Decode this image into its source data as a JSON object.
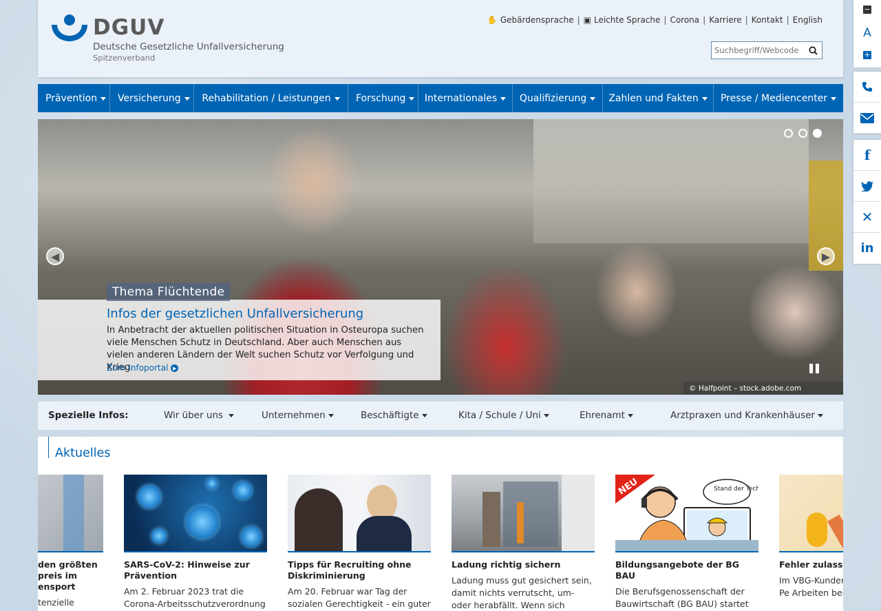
{
  "header": {
    "logo": {
      "brand": "DGUV",
      "line1": "Deutsche Gesetzliche Unfallversicherung",
      "line2": "Spitzenverband"
    },
    "topnav": [
      {
        "label": "Gebärdensprache",
        "icon": "sign-language-icon"
      },
      {
        "label": "Leichte Sprache",
        "icon": "easy-language-icon"
      },
      {
        "label": "Corona"
      },
      {
        "label": "Karriere"
      },
      {
        "label": "Kontakt"
      },
      {
        "label": "English"
      }
    ],
    "search": {
      "placeholder": "Suchbegriff/Webcode"
    }
  },
  "mainnav": [
    "Prävention",
    "Versicherung",
    "Rehabilitation / Leistungen",
    "Forschung",
    "Internationales",
    "Qualifizierung",
    "Zahlen und Fakten",
    "Presse / Mediencenter"
  ],
  "hero": {
    "tag": "Thema Flüchtende",
    "title": "Infos der gesetzlichen Unfallversicherung",
    "text": "In Anbetracht der aktuellen politischen Situation in Osteuropa suchen viele Menschen Schutz in Deutschland. Aber auch Menschen aus vielen anderen Ländern der Welt suchen Schutz vor Verfolgung und Krieg.",
    "link": "Zum Infoportal",
    "credit": "© Halfpoint – stock.adobe.com",
    "slides": 3,
    "active_slide": 3
  },
  "special": {
    "label": "Spezielle Infos:",
    "items": [
      "Wir über uns",
      "Unternehmen",
      "Beschäftigte",
      "Kita / Schule / Uni",
      "Ehrenamt",
      "Arztpraxen und Krankenhäuser"
    ]
  },
  "news": {
    "heading": "Aktuelles",
    "cards": [
      {
        "title": "den größten\npreis im\nensport",
        "text": "tenzielle"
      },
      {
        "title": "SARS-CoV-2: Hinweise zur Prävention",
        "text": "Am 2. Februar 2023 trat die Corona-Arbeitsschutzverordnung außer"
      },
      {
        "title": "Tipps für Recruiting ohne Diskriminierung",
        "text": "Am 20. Februar war Tag der sozialen Gerechtigkeit - ein guter Anlass, um"
      },
      {
        "title": "Ladung richtig sichern",
        "text": "Ladung muss gut gesichert sein, damit nichts verrutscht, um- oder herabfällt. Wenn sich Gegenstände"
      },
      {
        "title": "Bildungsangebote der BG BAU",
        "text": "Die Berufsgenossenschaft der Bauwirtschaft (BG BAU) startet im Frühling neue Online-",
        "badge": "NEU",
        "bubble": "Stand der Technik"
      },
      {
        "title": "Fehler zulassen",
        "text": "Im VBG-Kundenm berichtet Ralf Pe Arbeiten bei der"
      }
    ]
  },
  "sidebar": {
    "font_minus": "−",
    "font_label": "A",
    "font_plus": "+",
    "icons": [
      "phone-icon",
      "mail-icon",
      "facebook-icon",
      "twitter-icon",
      "xing-icon",
      "linkedin-icon"
    ]
  },
  "colors": {
    "brand_blue": "#0064b4",
    "header_bg": "#eaf1f8"
  }
}
